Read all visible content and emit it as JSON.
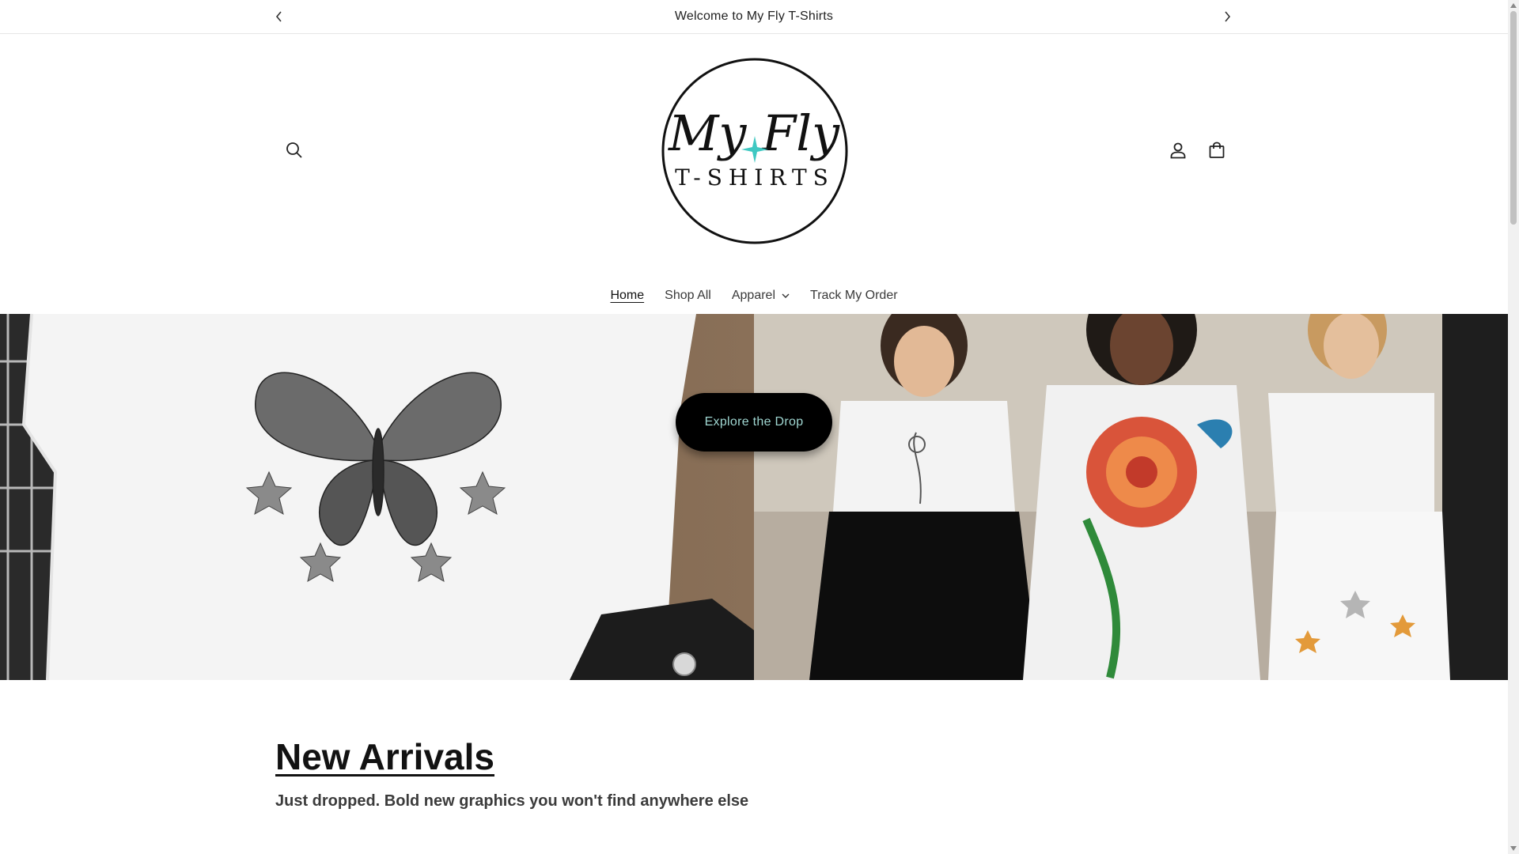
{
  "announcement": {
    "text": "Welcome to My Fly T-Shirts"
  },
  "header": {
    "logo_line1": "My Fly",
    "logo_line2": "T-SHIRTS",
    "icons": [
      "search-icon",
      "account-icon",
      "cart-icon"
    ]
  },
  "nav": {
    "items": [
      {
        "label": "Home",
        "active": true
      },
      {
        "label": "Shop All"
      },
      {
        "label": "Apparel",
        "has_dropdown": true
      },
      {
        "label": "Track My Order"
      }
    ]
  },
  "hero": {
    "button_label": "Explore the Drop"
  },
  "collection": {
    "title": "New Arrivals",
    "subtitle": "Just dropped. Bold new graphics you won't find anywhere else"
  },
  "colors": {
    "accent": "#3fc8c2",
    "button_bg": "#000000",
    "button_text": "#9fd6d1"
  }
}
